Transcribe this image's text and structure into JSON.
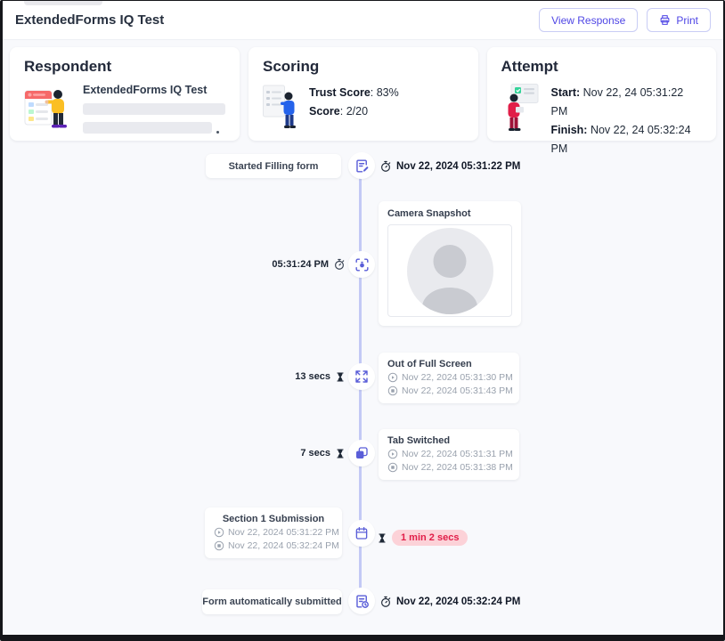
{
  "header": {
    "title": "ExtendedForms IQ Test",
    "buttons": {
      "view_response": "View Response",
      "print": "Print"
    }
  },
  "cards": {
    "respondent": {
      "title": "Respondent",
      "form_name": "ExtendedForms IQ Test"
    },
    "scoring": {
      "title": "Scoring",
      "trust_label": "Trust Score",
      "trust_value": ": 83%",
      "score_label": "Score",
      "score_value": ": 2/20"
    },
    "attempt": {
      "title": "Attempt",
      "start_label": "Start:",
      "start_value": "Nov 22, 24 05:31:22 PM",
      "finish_label": "Finish:",
      "finish_value": "Nov 22, 24 05:32:24 PM"
    }
  },
  "timeline": {
    "started": {
      "label": "Started Filling form",
      "timestamp": "Nov 22, 2024 05:31:22 PM"
    },
    "camera": {
      "title": "Camera Snapshot",
      "time": "05:31:24 PM"
    },
    "fullscreen": {
      "title": "Out of Full Screen",
      "duration": "13 secs",
      "start": "Nov 22, 2024 05:31:30 PM",
      "end": "Nov 22, 2024 05:31:43 PM"
    },
    "tab_switch": {
      "title": "Tab Switched",
      "duration": "7 secs",
      "start": "Nov 22, 2024 05:31:31 PM",
      "end": "Nov 22, 2024 05:31:38 PM"
    },
    "section1": {
      "title": "Section 1 Submission",
      "start": "Nov 22, 2024 05:31:22 PM",
      "end": "Nov 22, 2024 05:32:24 PM",
      "duration": "1 min 2 secs"
    },
    "submitted": {
      "label": "Form automatically submitted",
      "timestamp": "Nov 22, 2024 05:32:24 PM"
    }
  },
  "colors": {
    "accent": "#4f46e5",
    "node_icon": "#5a5ed8",
    "timeline_line": "#c3c9f5",
    "duration_pill_bg": "#fcd2d8",
    "duration_pill_text": "#e11d48"
  }
}
